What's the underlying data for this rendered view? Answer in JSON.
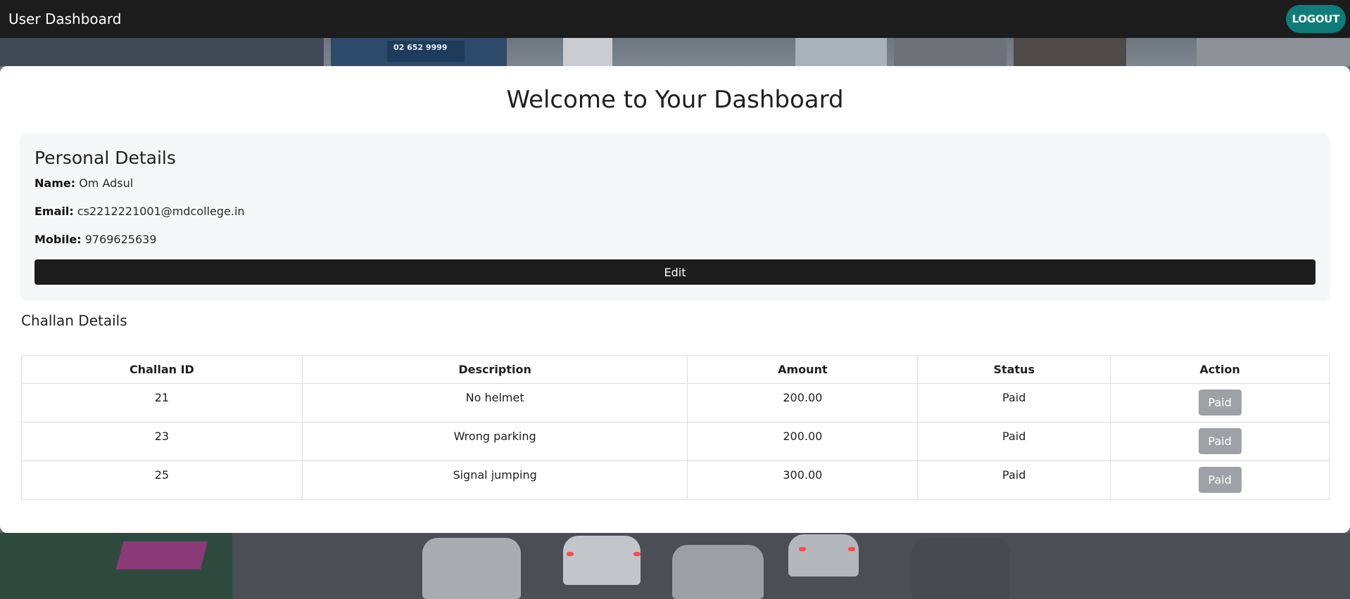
{
  "navbar": {
    "brand": "User Dashboard",
    "logout_label": "LOGOUT"
  },
  "main": {
    "welcome_title": "Welcome to Your Dashboard"
  },
  "personal": {
    "title": "Personal Details",
    "name_label": "Name:",
    "name_value": "Om Adsul",
    "email_label": "Email:",
    "email_value": "cs2212221001@mdcollege.in",
    "mobile_label": "Mobile:",
    "mobile_value": "9769625639",
    "edit_label": "Edit"
  },
  "challan": {
    "title": "Challan Details",
    "columns": [
      "Challan ID",
      "Description",
      "Amount",
      "Status",
      "Action"
    ],
    "rows": [
      {
        "id": "21",
        "description": "No helmet",
        "amount": "200.00",
        "status": "Paid",
        "action": "Paid"
      },
      {
        "id": "23",
        "description": "Wrong parking",
        "amount": "200.00",
        "status": "Paid",
        "action": "Paid"
      },
      {
        "id": "25",
        "description": "Signal jumping",
        "amount": "300.00",
        "status": "Paid",
        "action": "Paid"
      }
    ]
  },
  "background": {
    "billboard_text": "02 652 9999"
  },
  "colors": {
    "navbar_bg": "#1c1c1c",
    "logout_bg": "#0f7c7a",
    "edit_bg": "#1c1c1c",
    "paid_button_bg": "#9ea2a6",
    "card_bg": "#ffffff",
    "personal_bg": "#f6f7f9"
  }
}
